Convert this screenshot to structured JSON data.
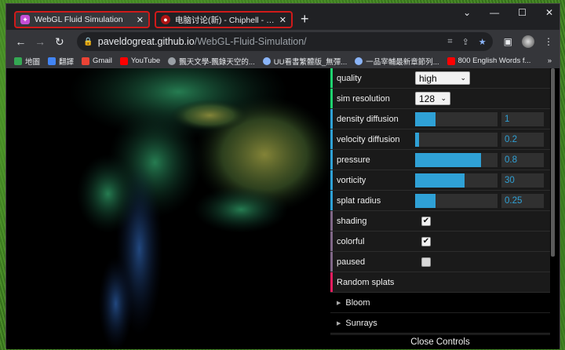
{
  "window": {
    "tabs": [
      {
        "title": "WebGL Fluid Simulation",
        "icon": "webgl-favicon-icon"
      },
      {
        "title": "电脑讨论(新) - Chiphell - 分享与交流",
        "icon": "chiphell-favicon-icon"
      }
    ],
    "new_tab_label": "+",
    "controls": {
      "minimize": "⌄",
      "min": "—",
      "max": "☐",
      "close": "✕"
    }
  },
  "toolbar": {
    "back": "←",
    "forward": "→",
    "reload": "↻",
    "url_host": "paveldogreat.github.io",
    "url_path": "/WebGL-Fluid-Simulation/"
  },
  "bookmarks": [
    {
      "label": "地圖",
      "color": "#34a853"
    },
    {
      "label": "翻譯",
      "color": "#4285f4"
    },
    {
      "label": "Gmail",
      "color": "#ea4335"
    },
    {
      "label": "YouTube",
      "color": "#ff0000"
    },
    {
      "label": "飄天文學-飄錄天空的...",
      "color": "#9aa0a6"
    },
    {
      "label": "UU看書繁體版_無彈...",
      "color": "#8ab4f8"
    },
    {
      "label": "一品宰輔最新章節列...",
      "color": "#8ab4f8"
    },
    {
      "label": "800 English Words f...",
      "color": "#ff0000"
    }
  ],
  "bookmarks_more": "»",
  "controls": {
    "quality": {
      "label": "quality",
      "value": "high"
    },
    "sim_resolution": {
      "label": "sim resolution",
      "value": "128"
    },
    "density_diffusion": {
      "label": "density diffusion",
      "value": "1",
      "fill": 0.25
    },
    "velocity_diffusion": {
      "label": "velocity diffusion",
      "value": "0.2",
      "fill": 0.05
    },
    "pressure": {
      "label": "pressure",
      "value": "0.8",
      "fill": 0.8
    },
    "vorticity": {
      "label": "vorticity",
      "value": "30",
      "fill": 0.6
    },
    "splat_radius": {
      "label": "splat radius",
      "value": "0.25",
      "fill": 0.25
    },
    "shading": {
      "label": "shading",
      "checked": true
    },
    "colorful": {
      "label": "colorful",
      "checked": true
    },
    "paused": {
      "label": "paused",
      "checked": false
    },
    "random_splats": {
      "label": "Random splats"
    },
    "bloom": {
      "label": "Bloom"
    },
    "sunrays": {
      "label": "Sunrays"
    },
    "close_controls": "Close Controls"
  },
  "colors": {
    "accent": "#2fa1d6",
    "select_marker": "#1ed36f",
    "function_marker": "#e61d5f",
    "boolean_marker": "#806787"
  }
}
